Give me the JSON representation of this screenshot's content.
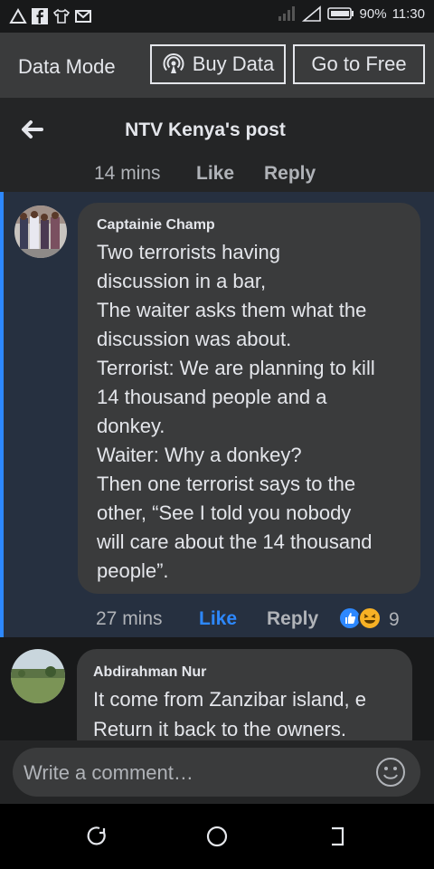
{
  "statusbar": {
    "battery": "90%",
    "time": "11:30"
  },
  "databar": {
    "mode_label": "Data Mode",
    "buy_label": "Buy Data",
    "free_label": "Go to Free"
  },
  "header": {
    "title": "NTV Kenya's post"
  },
  "prev_comment": {
    "time": "14 mins",
    "like": "Like",
    "reply": "Reply"
  },
  "comment1": {
    "author": "Captainie Champ",
    "text": "Two terrorists having\ndiscussion in a bar,\nThe waiter asks them what the\ndiscussion was about.\nTerrorist: We are planning to kill\n14 thousand people and a\ndonkey.\nWaiter: Why a donkey?\nThen one terrorist says to the\nother, “See I told you nobody\nwill care about the 14 thousand\npeople”.",
    "time": "27 mins",
    "like": "Like",
    "reply": "Reply",
    "reaction_count": "9"
  },
  "comment2": {
    "author": "Abdirahman Nur",
    "text": "It come from Zanzibar island, e\nReturn it back to the owners."
  },
  "composer": {
    "placeholder": "Write a comment…"
  },
  "colors": {
    "accent": "#2d88ff",
    "background": "#18191a",
    "bubble": "#3a3b3c"
  }
}
